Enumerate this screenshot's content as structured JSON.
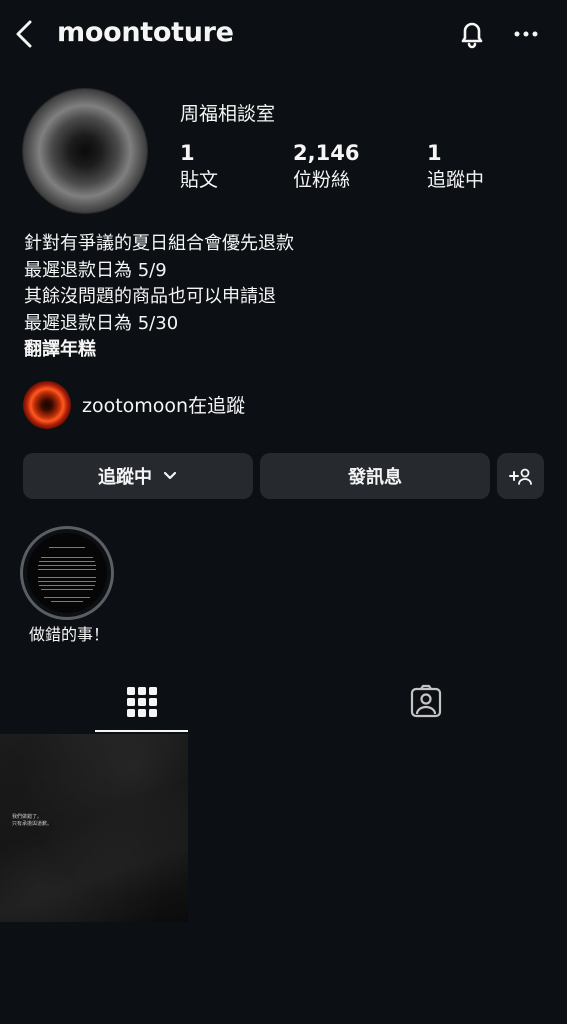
{
  "header": {
    "username": "moontoture"
  },
  "profile": {
    "display_name": "周福相談室",
    "stats": [
      {
        "value": "1",
        "label": "貼文"
      },
      {
        "value": "2,146",
        "label": "位粉絲"
      },
      {
        "value": "1",
        "label": "追蹤中"
      }
    ],
    "bio_lines": [
      "針對有爭議的夏日組合會優先退款",
      "最遲退款日為 5/9",
      "其餘沒問題的商品也可以申請退",
      "最遲退款日為 5/30"
    ],
    "bio_bold": "翻譯年糕"
  },
  "followed_by": {
    "name": "zootomoon",
    "suffix": "在追蹤"
  },
  "actions": {
    "following_label": "追蹤中",
    "message_label": "發訊息"
  },
  "highlights": [
    {
      "label": "做錯的事！"
    }
  ],
  "post": {
    "line1": "我們做錯了。",
    "line2": "只有承擔與道歉。"
  },
  "colors": {
    "background": "#0c1014",
    "button": "#262a2f",
    "text": "#f5f5f5"
  }
}
